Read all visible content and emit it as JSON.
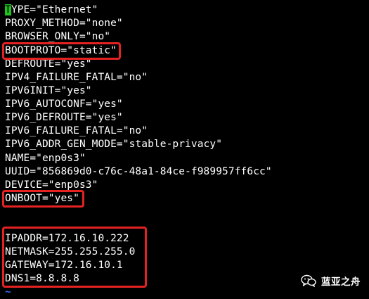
{
  "terminal": {
    "cursor_char": "T",
    "lines": [
      "YPE=\"Ethernet\"",
      "PROXY_METHOD=\"none\"",
      "BROWSER_ONLY=\"no\"",
      "BOOTPROTO=\"static\"",
      "DEFROUTE=\"yes\"",
      "IPV4_FAILURE_FATAL=\"no\"",
      "IPV6INIT=\"yes\"",
      "IPV6_AUTOCONF=\"yes\"",
      "IPV6_DEFROUTE=\"yes\"",
      "IPV6_FAILURE_FATAL=\"no\"",
      "IPV6_ADDR_GEN_MODE=\"stable-privacy\"",
      "NAME=\"enp0s3\"",
      "UUID=\"856869d0-c76c-48a1-84ce-f989957ff6cc\"",
      "DEVICE=\"enp0s3\"",
      "ONBOOT=\"yes\"",
      "",
      "",
      "IPADDR=172.16.10.222",
      "NETMASK=255.255.255.0",
      "GATEWAY=172.16.10.1",
      "DNS1=8.8.8.8"
    ],
    "tilde": "~"
  },
  "watermark": {
    "name": "蓝亚之舟",
    "icon": "chat-bubbles-icon"
  },
  "colors": {
    "background": "#000000",
    "text": "#ffffff",
    "cursor": "#21c321",
    "highlight_border": "#e42222",
    "tilde": "#3a6fff"
  }
}
